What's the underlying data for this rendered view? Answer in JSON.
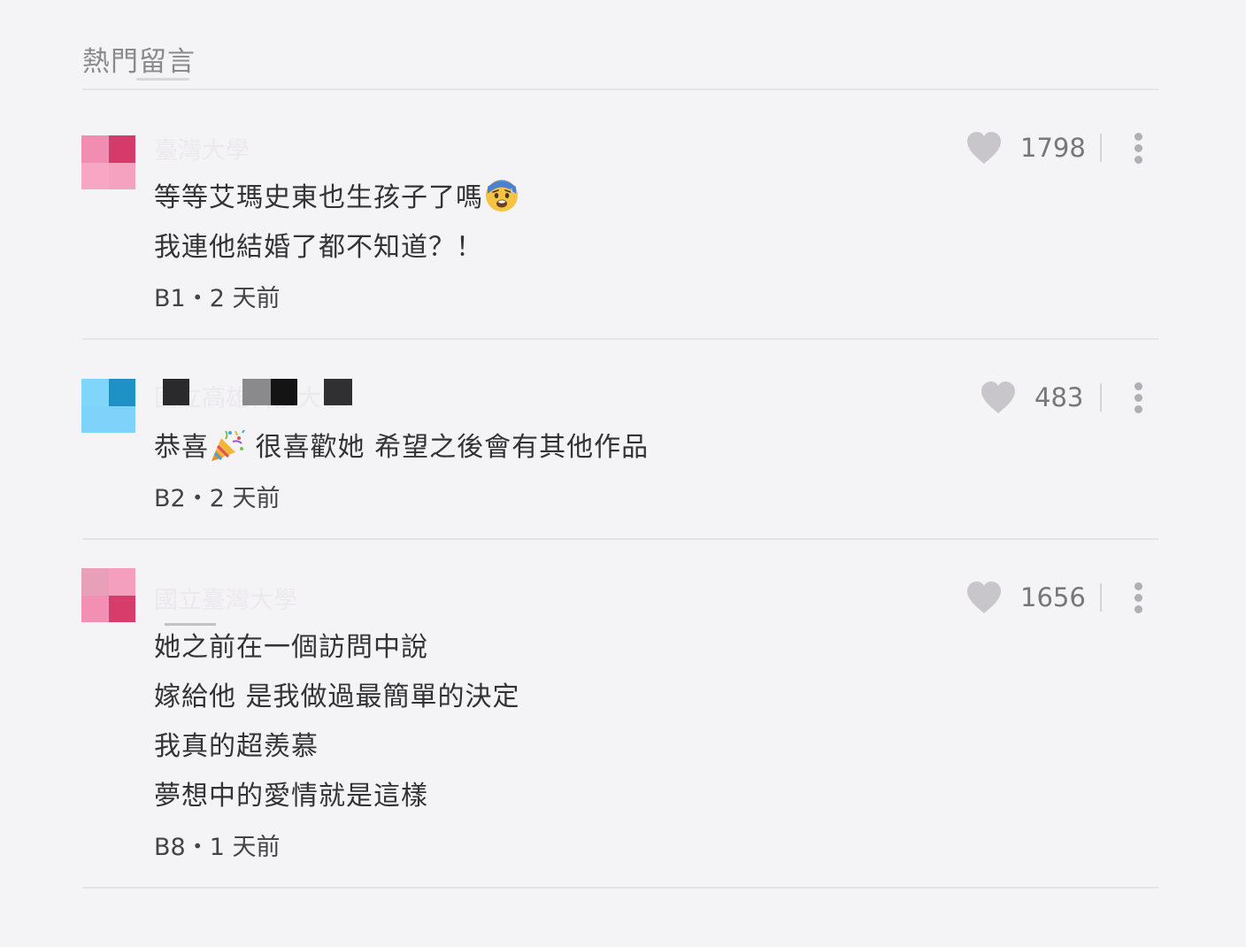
{
  "section": {
    "title": "熱門留言"
  },
  "comments": [
    {
      "author": "臺灣大學",
      "lines": [
        "等等艾瑪史東也生孩子了嗎",
        "我連他結婚了都不知道？！"
      ],
      "emoji": "anxious-face-icon",
      "floor_time": "B1・2 天前",
      "likes": "1798",
      "avatar_colors": [
        "#f08db0",
        "#d53a6a",
        "#f7a7c4",
        "#f4a2bf"
      ]
    },
    {
      "author": "國立高雄科技大學",
      "lines": [
        "恭喜",
        " 很喜歡她 希望之後會有其他作品"
      ],
      "emoji": "party-popper-icon",
      "floor_time": "B2・2 天前",
      "likes": "483",
      "avatar_colors": [
        "#7fd6fa",
        "#1e92c4",
        "#7ed3fb",
        "#7fd3fa"
      ]
    },
    {
      "author": "國立臺灣大學",
      "lines": [
        "她之前在一個訪問中說",
        "嫁給他 是我做過最簡單的決定",
        "我真的超羨慕",
        "夢想中的愛情就是這樣"
      ],
      "floor_time": "B8・1 天前",
      "likes": "1656",
      "avatar_colors": [
        "#e7a0b7",
        "#f59fbf",
        "#f38fb3",
        "#d63d6b"
      ]
    }
  ],
  "icons": {
    "like": "heart-icon",
    "more": "more-vertical-icon"
  },
  "colors": {
    "background": "#f4f3f6",
    "text": "#333333",
    "muted": "#8a8a8c",
    "heart": "#c8c6cb",
    "divider": "#e4e3e6"
  }
}
